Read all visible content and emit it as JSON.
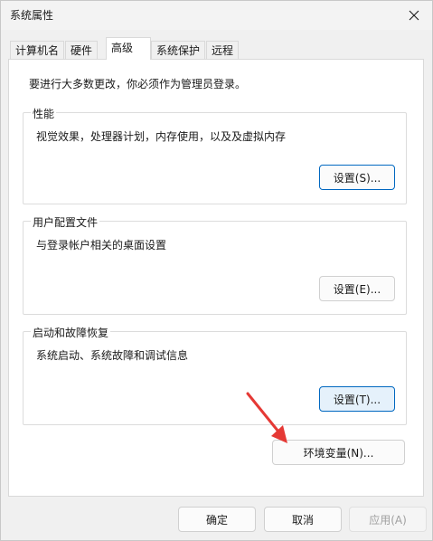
{
  "window": {
    "title": "系统属性"
  },
  "tabs": [
    {
      "label": "计算机名"
    },
    {
      "label": "硬件"
    },
    {
      "label": "高级"
    },
    {
      "label": "系统保护"
    },
    {
      "label": "远程"
    }
  ],
  "active_tab": "高级",
  "intro": "要进行大多数更改，你必须作为管理员登录。",
  "performance": {
    "title": "性能",
    "description": "视觉效果，处理器计划，内存使用，以及及虚拟内存",
    "button": "设置(S)..."
  },
  "user_profiles": {
    "title": "用户配置文件",
    "description": "与登录帐户相关的桌面设置",
    "button": "设置(E)..."
  },
  "startup_recovery": {
    "title": "启动和故障恢复",
    "description": "系统启动、系统故障和调试信息",
    "button": "设置(T)..."
  },
  "env_button": "环境变量(N)...",
  "footer": {
    "ok": "确定",
    "cancel": "取消",
    "apply": "应用(A)"
  },
  "colors": {
    "accent": "#0067c0",
    "arrow": "#e53935"
  },
  "icons": {
    "close": "close-icon",
    "annotation": "red-arrow-icon"
  }
}
